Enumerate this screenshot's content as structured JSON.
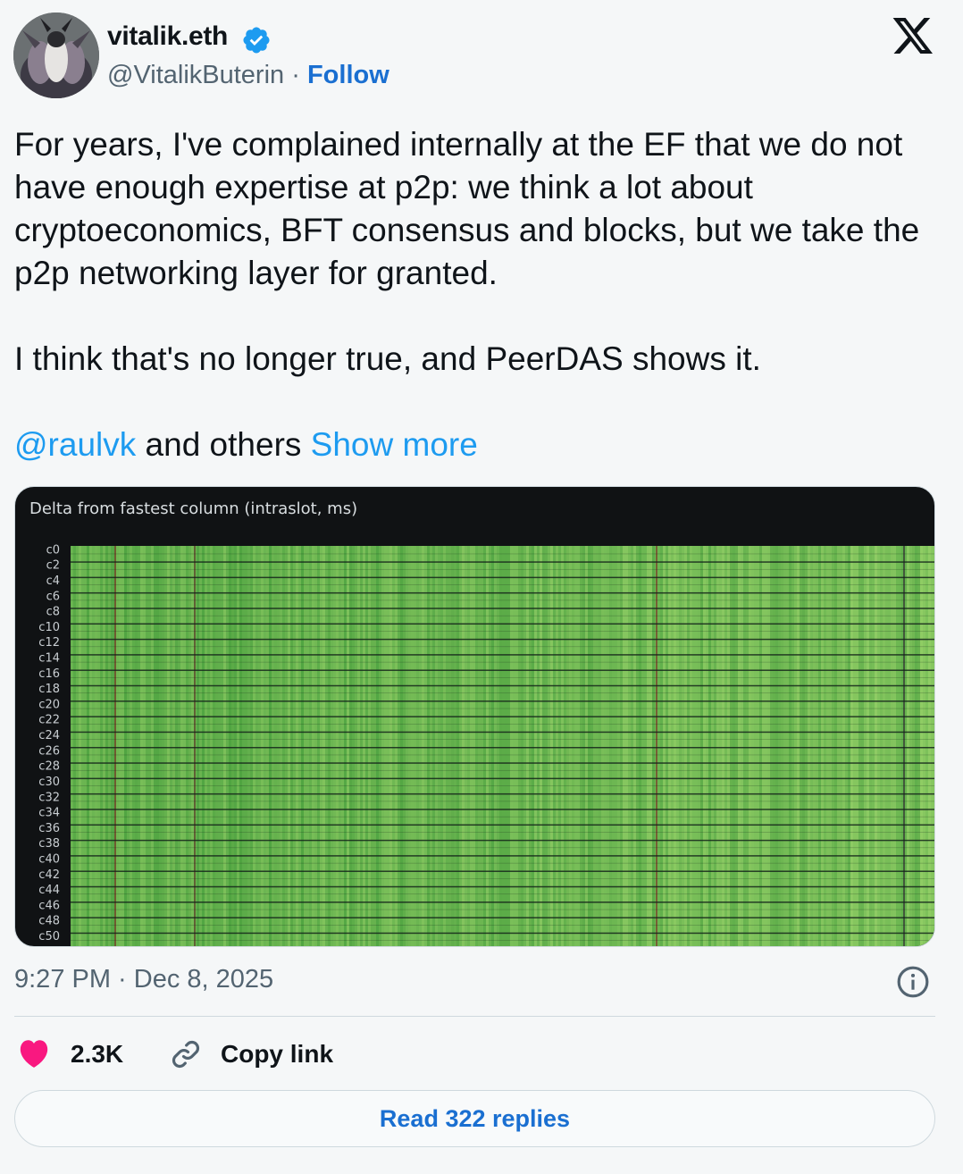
{
  "author": {
    "name": "vitalik.eth",
    "handle": "@VitalikButerin",
    "separator": "·",
    "follow_label": "Follow",
    "verified_icon": "verified-badge-icon"
  },
  "tweet": {
    "paragraph1": "For years, I've complained internally at the EF that we do not have enough expertise at p2p: we think a lot about cryptoeconomics, BFT consensus and blocks, but we take the p2p networking layer for granted.",
    "paragraph2": "I think that's no longer true, and PeerDAS shows it.",
    "mention": "@raulvk",
    "paragraph3_rest": " and others ",
    "show_more": "Show more"
  },
  "media": {
    "chart_title": "Delta from fastest column (intraslot, ms)",
    "row_labels": [
      "c0",
      "c2",
      "c4",
      "c6",
      "c8",
      "c10",
      "c12",
      "c14",
      "c16",
      "c18",
      "c20",
      "c22",
      "c24",
      "c26",
      "c28",
      "c30",
      "c32",
      "c34",
      "c36",
      "c38",
      "c40",
      "c42",
      "c44",
      "c46",
      "c48",
      "c50"
    ],
    "colors": {
      "background": "#101214",
      "cell_dark": "#3c9a3a",
      "cell_light": "#9fd870",
      "separator": "#1a1d1f"
    }
  },
  "meta": {
    "timestamp": "9:27 PM · Dec 8, 2025"
  },
  "actions": {
    "likes": "2.3K",
    "copy_link": "Copy link",
    "read_replies": "Read 322 replies"
  },
  "colors": {
    "accent": "#1d9bf0",
    "heart": "#f91880",
    "text_secondary": "#536471"
  }
}
